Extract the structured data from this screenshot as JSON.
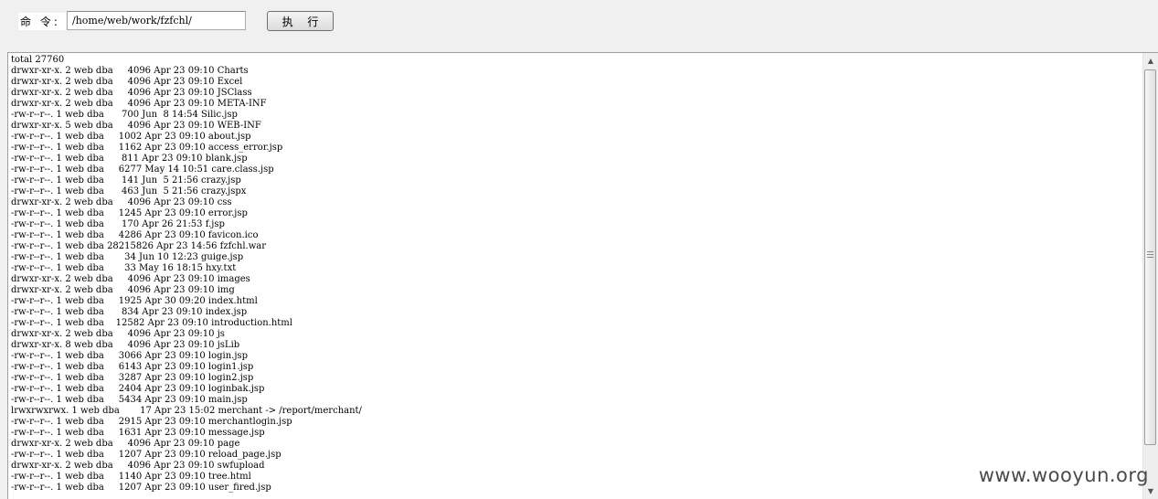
{
  "toolbar": {
    "command_label": "命 令:",
    "command_value": "/home/web/work/fzfchl/",
    "execute_label": "执 行"
  },
  "output": {
    "lines": [
      "total 27760",
      "drwxr-xr-x. 2 web dba     4096 Apr 23 09:10 Charts",
      "drwxr-xr-x. 2 web dba     4096 Apr 23 09:10 Excel",
      "drwxr-xr-x. 2 web dba     4096 Apr 23 09:10 JSClass",
      "drwxr-xr-x. 2 web dba     4096 Apr 23 09:10 META-INF",
      "-rw-r--r--. 1 web dba      700 Jun  8 14:54 Silic.jsp",
      "drwxr-xr-x. 5 web dba     4096 Apr 23 09:10 WEB-INF",
      "-rw-r--r--. 1 web dba     1002 Apr 23 09:10 about.jsp",
      "-rw-r--r--. 1 web dba     1162 Apr 23 09:10 access_error.jsp",
      "-rw-r--r--. 1 web dba      811 Apr 23 09:10 blank.jsp",
      "-rw-r--r--. 1 web dba     6277 May 14 10:51 care.class.jsp",
      "-rw-r--r--. 1 web dba      141 Jun  5 21:56 crazy.jsp",
      "-rw-r--r--. 1 web dba      463 Jun  5 21:56 crazy.jspx",
      "drwxr-xr-x. 2 web dba     4096 Apr 23 09:10 css",
      "-rw-r--r--. 1 web dba     1245 Apr 23 09:10 error.jsp",
      "-rw-r--r--. 1 web dba      170 Apr 26 21:53 f.jsp",
      "-rw-r--r--. 1 web dba     4286 Apr 23 09:10 favicon.ico",
      "-rw-r--r--. 1 web dba 28215826 Apr 23 14:56 fzfchl.war",
      "-rw-r--r--. 1 web dba       34 Jun 10 12:23 guige.jsp",
      "-rw-r--r--. 1 web dba       33 May 16 18:15 hxy.txt",
      "drwxr-xr-x. 2 web dba     4096 Apr 23 09:10 images",
      "drwxr-xr-x. 2 web dba     4096 Apr 23 09:10 img",
      "-rw-r--r--. 1 web dba     1925 Apr 30 09:20 index.html",
      "-rw-r--r--. 1 web dba      834 Apr 23 09:10 index.jsp",
      "-rw-r--r--. 1 web dba    12582 Apr 23 09:10 introduction.html",
      "drwxr-xr-x. 2 web dba     4096 Apr 23 09:10 js",
      "drwxr-xr-x. 8 web dba     4096 Apr 23 09:10 jsLib",
      "-rw-r--r--. 1 web dba     3066 Apr 23 09:10 login.jsp",
      "-rw-r--r--. 1 web dba     6143 Apr 23 09:10 login1.jsp",
      "-rw-r--r--. 1 web dba     3287 Apr 23 09:10 login2.jsp",
      "-rw-r--r--. 1 web dba     2404 Apr 23 09:10 loginbak.jsp",
      "-rw-r--r--. 1 web dba     5434 Apr 23 09:10 main.jsp",
      "lrwxrwxrwx. 1 web dba       17 Apr 23 15:02 merchant -> /report/merchant/",
      "-rw-r--r--. 1 web dba     2915 Apr 23 09:10 merchantlogin.jsp",
      "-rw-r--r--. 1 web dba     1631 Apr 23 09:10 message.jsp",
      "drwxr-xr-x. 2 web dba     4096 Apr 23 09:10 page",
      "-rw-r--r--. 1 web dba     1207 Apr 23 09:10 reload_page.jsp",
      "drwxr-xr-x. 2 web dba     4096 Apr 23 09:10 swfupload",
      "-rw-r--r--. 1 web dba     1140 Apr 23 09:10 tree.html",
      "-rw-r--r--. 1 web dba     1207 Apr 23 09:10 user_fired.jsp"
    ]
  },
  "scrollbar": {
    "up_icon": "▲",
    "down_icon": "▼"
  },
  "watermark": "www.wooyun.org"
}
